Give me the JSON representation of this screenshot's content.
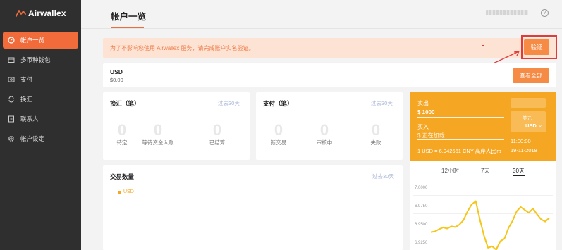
{
  "brand": {
    "name": "Airwallex",
    "accent": "#f26b3a"
  },
  "sidebar": {
    "items": [
      {
        "label": "帐户一览",
        "icon": "dashboard-icon",
        "active": true
      },
      {
        "label": "多币种钱包",
        "icon": "wallet-icon",
        "active": false
      },
      {
        "label": "支付",
        "icon": "payment-icon",
        "active": false
      },
      {
        "label": "换汇",
        "icon": "exchange-icon",
        "active": false
      },
      {
        "label": "联系人",
        "icon": "contacts-icon",
        "active": false
      },
      {
        "label": "帐户设定",
        "icon": "gear-icon",
        "active": false
      }
    ]
  },
  "header": {
    "title": "帐户一览",
    "help_icon": "?"
  },
  "banner": {
    "text": "为了不影响您使用 Airwallex 服务，请完成账户实名验证。",
    "verify_label": "验证"
  },
  "balance": {
    "currency": "USD",
    "amount": "$0.00",
    "view_all_label": "查看全部"
  },
  "exchange_card": {
    "title": "换汇（笔）",
    "period": "过去30天",
    "stats": [
      {
        "value": "0",
        "label": "待定"
      },
      {
        "value": "0",
        "label": "等待资金入账"
      },
      {
        "value": "0",
        "label": "已结算"
      }
    ]
  },
  "payment_card": {
    "title": "支付（笔）",
    "period": "过去30天",
    "stats": [
      {
        "value": "0",
        "label": "新交易"
      },
      {
        "value": "0",
        "label": "审核中"
      },
      {
        "value": "0",
        "label": "失败"
      }
    ]
  },
  "volume_card": {
    "title": "交易数量",
    "period": "过去30天",
    "legend": "USD"
  },
  "fx": {
    "sell_label": "卖出",
    "sell_value": "$ 1000",
    "buy_label": "买入",
    "buy_value": "$ 正在加载",
    "currency_hint": "美元",
    "currency": "USD",
    "rate_text": "1 USD = 6.942661 CNY 离岸人民币",
    "time": "11:00:00",
    "date": "19-11-2018",
    "tabs": [
      "12小时",
      "7天",
      "30天"
    ],
    "active_tab": "30天",
    "panel_color": "#f5a623"
  },
  "chart_data": {
    "type": "line",
    "title": "",
    "xlabel": "",
    "ylabel": "",
    "y_ticks": [
      "7.0000",
      "6.9750",
      "6.9500",
      "6.9250"
    ],
    "ylim": [
      6.915,
      7.0
    ],
    "x": [
      0,
      1,
      2,
      3,
      4,
      5,
      6,
      7,
      8,
      9,
      10,
      11,
      12,
      13,
      14,
      15,
      16,
      17,
      18,
      19,
      20,
      21,
      22,
      23,
      24,
      25,
      26,
      27,
      28,
      29
    ],
    "series": [
      {
        "values": [
          6.9395,
          6.9405,
          6.9435,
          6.946,
          6.9445,
          6.9475,
          6.9465,
          6.95,
          6.956,
          6.968,
          6.9775,
          6.982,
          6.957,
          6.935,
          6.918,
          6.92,
          6.9155,
          6.927,
          6.9305,
          6.945,
          6.955,
          6.968,
          6.974,
          6.97,
          6.966,
          6.972,
          6.964,
          6.957,
          6.954,
          6.959
        ]
      }
    ],
    "color": "#f5c518"
  }
}
